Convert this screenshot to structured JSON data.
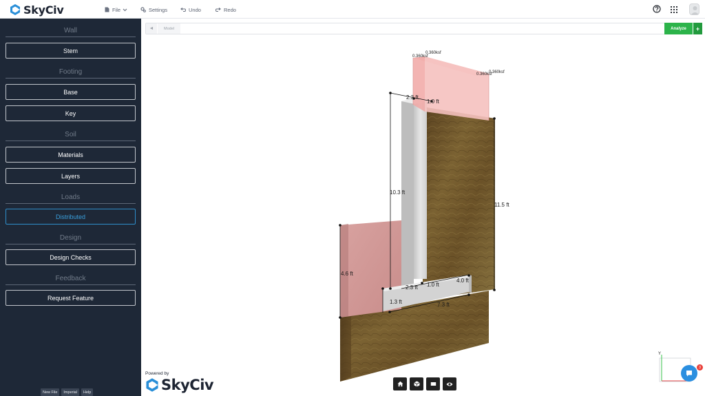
{
  "app": {
    "logo_text": "SkyCiv",
    "menu": {
      "file": "File",
      "settings": "Settings",
      "undo": "Undo",
      "redo": "Redo"
    }
  },
  "sidebar": {
    "sections": [
      {
        "title": "Wall",
        "buttons": [
          "Stem"
        ]
      },
      {
        "title": "Footing",
        "buttons": [
          "Base",
          "Key"
        ]
      },
      {
        "title": "Soil",
        "buttons": [
          "Materials",
          "Layers"
        ]
      },
      {
        "title": "Loads",
        "buttons": [
          "Distributed"
        ]
      },
      {
        "title": "Design",
        "buttons": [
          "Design Checks"
        ]
      },
      {
        "title": "Feedback",
        "buttons": [
          "Request Feature"
        ]
      }
    ],
    "active_button": "Distributed",
    "footer": {
      "new_file": "New File",
      "units": "Imperial",
      "help": "Help"
    }
  },
  "model_bar": {
    "tab": "Model",
    "analyze": "Analyze",
    "plus": "+"
  },
  "model": {
    "loads": [
      "0.360ksf",
      "0.360ksf",
      "0.360ksf",
      "0.360ksf"
    ],
    "dimensions": {
      "stem_top_width": "2.3 ft",
      "stem_top_offset": "1.0 ft",
      "stem_height": "10.3 ft",
      "retained_height": "11.5 ft",
      "front_soil_height": "4.6 ft",
      "toe_length": "2.3 ft",
      "stem_base_width": "1.0 ft",
      "heel_length": "4.0 ft",
      "footing_thickness": "1.3 ft",
      "footing_length": "7.3 ft"
    },
    "axis_label": "Y",
    "colors": {
      "backfill": "#6b5228",
      "front_soil": "#d9a5a3",
      "concrete": "#d8d8d8",
      "load": "#f5c1bf"
    }
  },
  "powered": {
    "label": "Powered by",
    "logo_text": "SkyCiv"
  },
  "chat": {
    "badge": "3"
  }
}
